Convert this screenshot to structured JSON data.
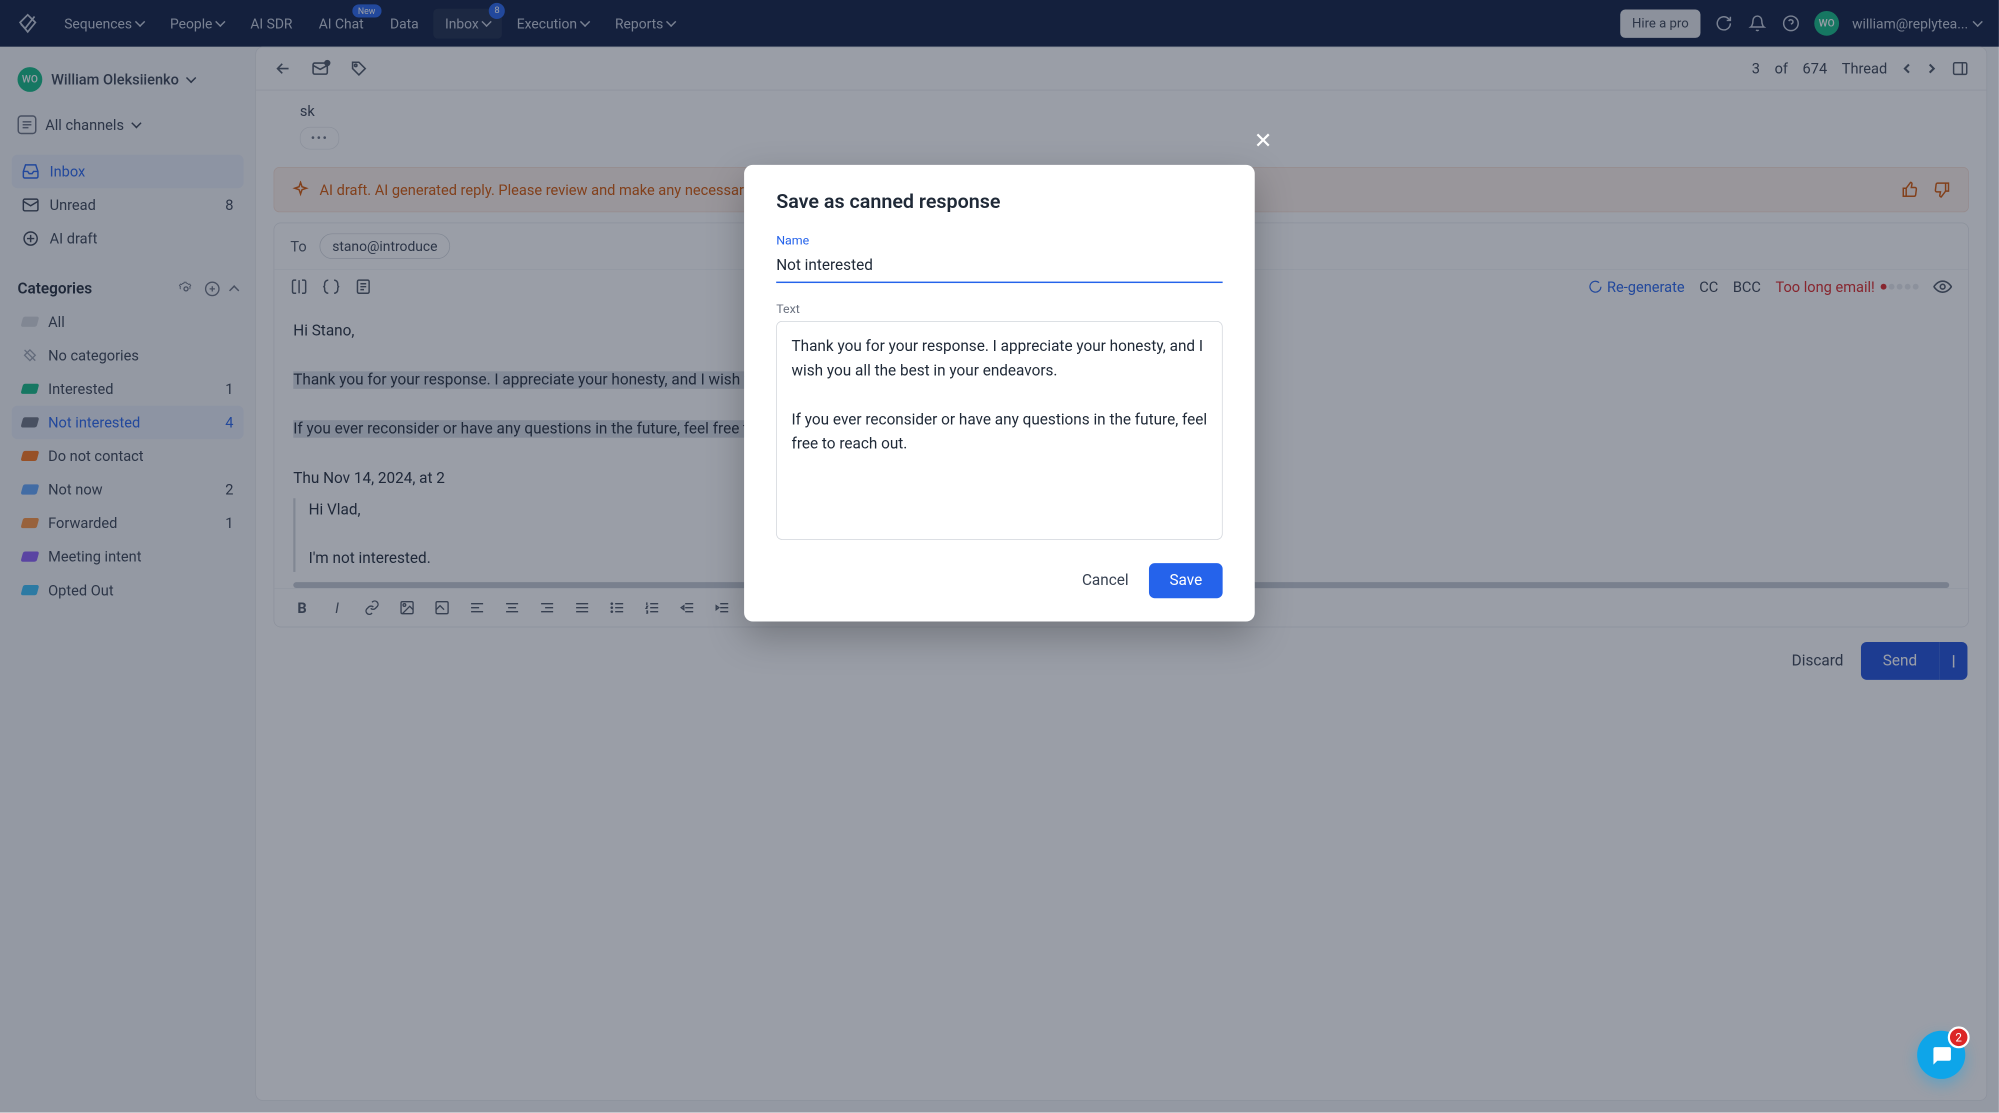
{
  "topnav": {
    "items": [
      "Sequences",
      "People",
      "AI SDR",
      "AI Chat",
      "Data",
      "Inbox",
      "Execution",
      "Reports"
    ],
    "new_badge": "New",
    "inbox_badge": "8",
    "hire": "Hire a pro",
    "user_initials": "WO",
    "user_email": "william@replytea..."
  },
  "sidebar": {
    "user_initials": "WO",
    "user_name": "William Oleksiienko",
    "channels": "All channels",
    "nav": [
      {
        "label": "Inbox",
        "count": ""
      },
      {
        "label": "Unread",
        "count": "8"
      },
      {
        "label": "AI draft",
        "count": ""
      }
    ],
    "categories_title": "Categories",
    "cats": [
      {
        "label": "All",
        "color": "#d1d5db",
        "count": ""
      },
      {
        "label": "No categories",
        "color": "",
        "count": ""
      },
      {
        "label": "Interested",
        "color": "#10b981",
        "count": "1"
      },
      {
        "label": "Not interested",
        "color": "#6b7280",
        "count": "4"
      },
      {
        "label": "Do not contact",
        "color": "#f97316",
        "count": ""
      },
      {
        "label": "Not now",
        "color": "#60a5fa",
        "count": "2"
      },
      {
        "label": "Forwarded",
        "color": "#fb923c",
        "count": "1"
      },
      {
        "label": "Meeting intent",
        "color": "#8b5cf6",
        "count": ""
      },
      {
        "label": "Opted Out",
        "color": "#38bdf8",
        "count": ""
      }
    ]
  },
  "thread": {
    "position": "3",
    "of": "of",
    "total": "674",
    "label": "Thread",
    "sk": "sk",
    "ai_banner": "AI draft. AI generated reply. Please review and make any necessary adjustments before sending.",
    "to_label": "To",
    "to_email": "stano@introduce",
    "regenerate": "Re-generate",
    "cc": "CC",
    "bcc": "BCC",
    "too_long": "Too long email!",
    "body_greeting": "Hi Stano,",
    "body_p1": "Thank you for your response. I appreciate your honesty, and I wish you all the best in your endeavors.",
    "body_p2": "If you ever reconsider or have any questions in the future, feel free to reach out.",
    "quote_date": "Thu Nov 14, 2024, at 2",
    "quote_greeting": "Hi Vlad,",
    "quote_text": "I'm not interested.",
    "discard": "Discard",
    "send": "Send"
  },
  "modal": {
    "title": "Save as canned response",
    "name_label": "Name",
    "name_value": "Not interested",
    "text_label": "Text",
    "text_value": "Thank you for your response. I appreciate your honesty, and I wish you all the best in your endeavors.\n\nIf you ever reconsider or have any questions in the future, feel free to reach out.",
    "cancel": "Cancel",
    "save": "Save"
  },
  "chat_badge": "2"
}
